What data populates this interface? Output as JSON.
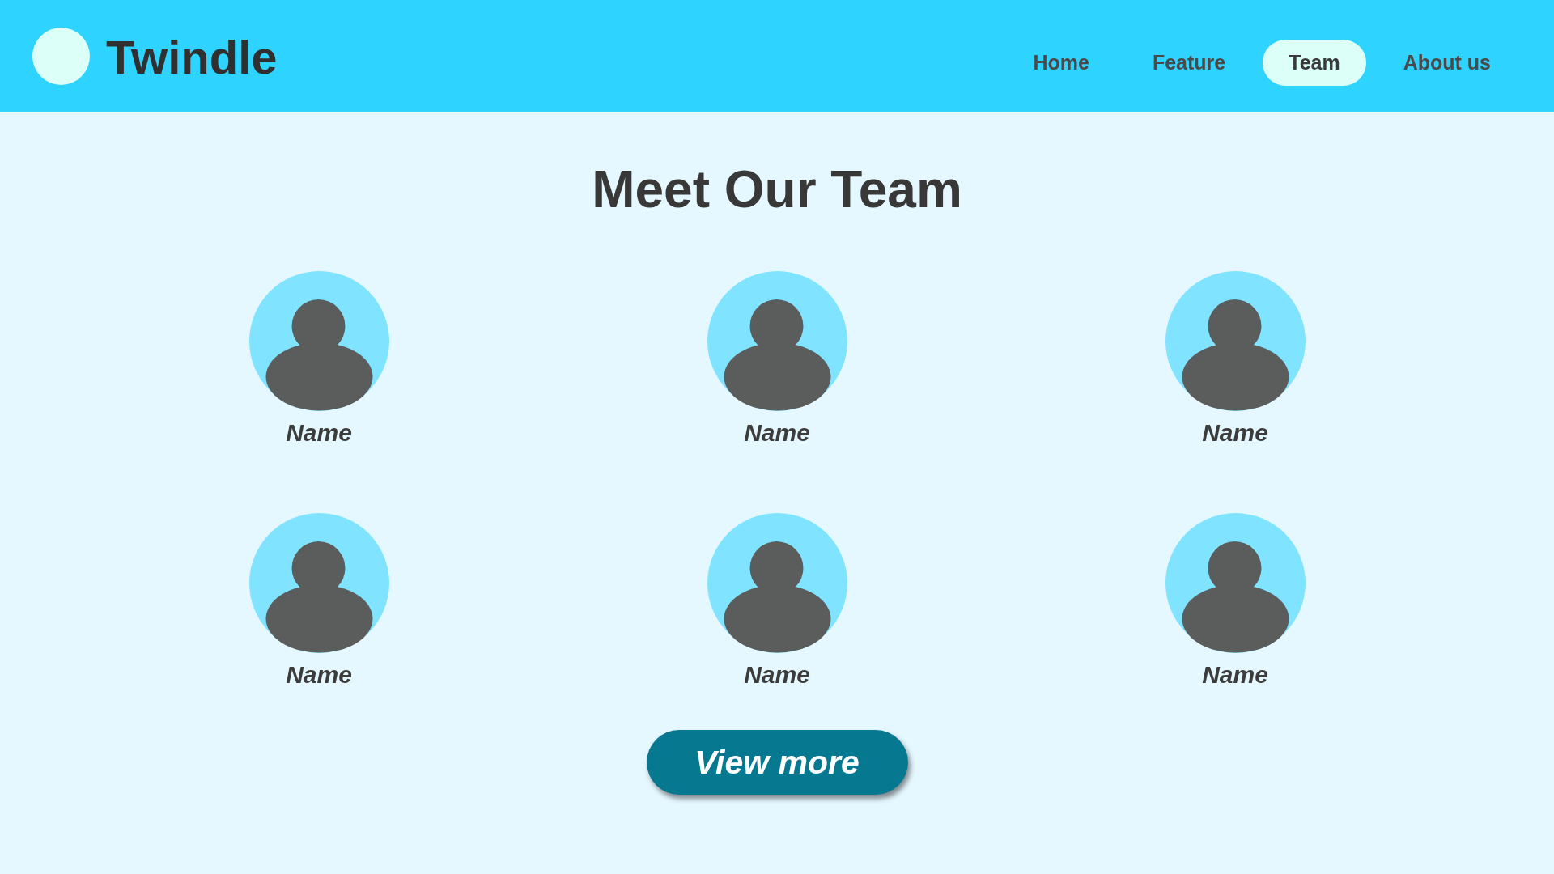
{
  "header": {
    "brand": "Twindle",
    "nav": [
      {
        "label": "Home",
        "selected": false
      },
      {
        "label": "Feature",
        "selected": false
      },
      {
        "label": "Team",
        "selected": true
      },
      {
        "label": "About us",
        "selected": false
      }
    ]
  },
  "team": {
    "title": "Meet Our Team",
    "members": [
      {
        "name": "Name"
      },
      {
        "name": "Name"
      },
      {
        "name": "Name"
      },
      {
        "name": "Name"
      },
      {
        "name": "Name"
      },
      {
        "name": "Name"
      }
    ],
    "button": "View more"
  }
}
